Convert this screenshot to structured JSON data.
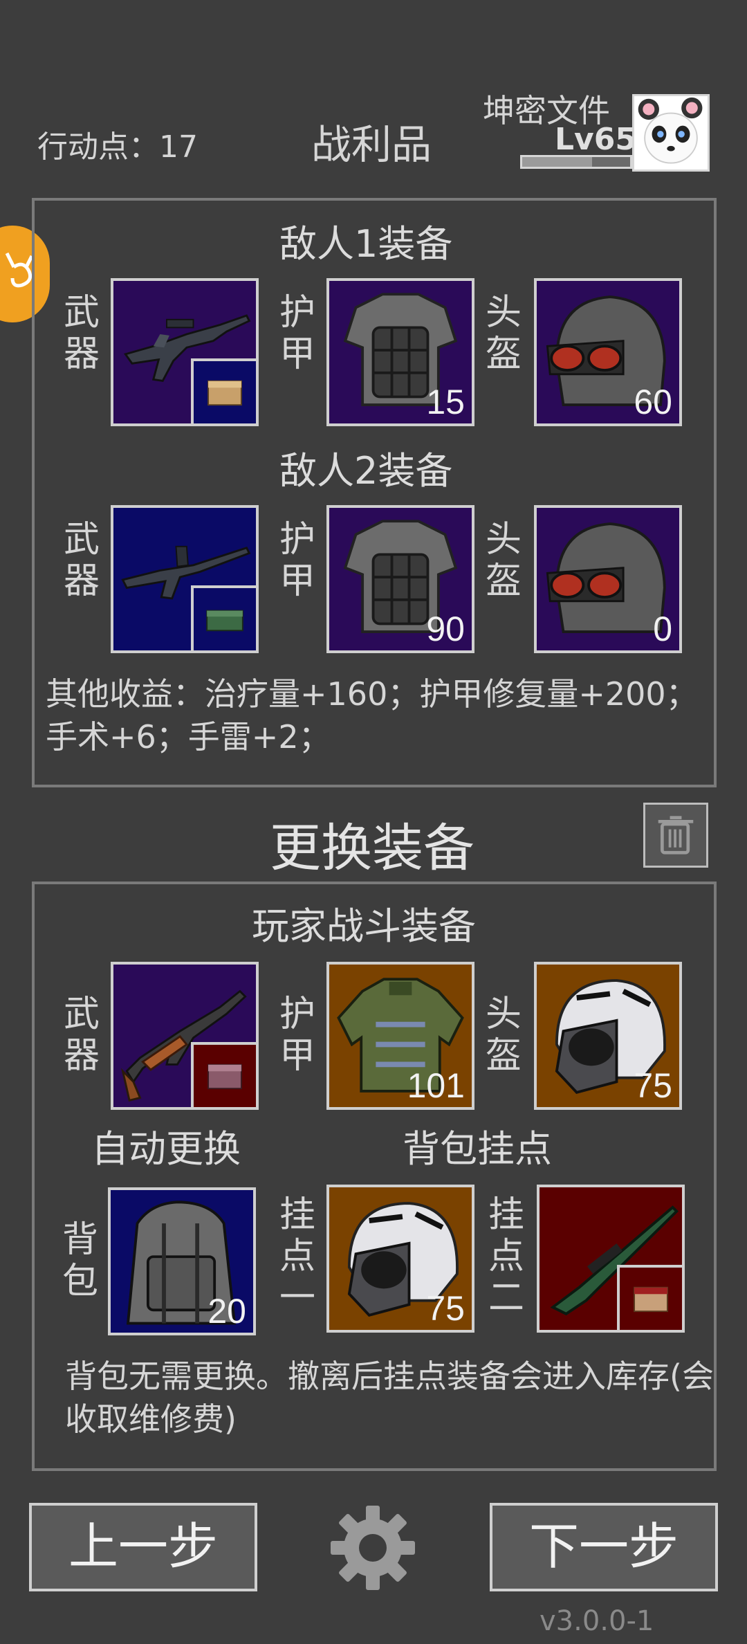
{
  "header": {
    "action_points": "行动点：17",
    "title": "战利品",
    "player_name": "坤密文件",
    "player_level": "Lv65",
    "xp_progress": 0.65,
    "avatar_icon": "panda-avatar-icon"
  },
  "loot": {
    "enemy1_title": "敌人1装备",
    "enemy2_title": "敌人2装备",
    "labels": {
      "weapon": "武器",
      "armor": "护甲",
      "helmet": "头盔"
    },
    "enemy1": {
      "armor_value": "15",
      "helmet_value": "60"
    },
    "enemy2": {
      "armor_value": "90",
      "helmet_value": "0"
    },
    "other_gains": "其他收益：治疗量+160；护甲修复量+200；手术+6；手雷+2；"
  },
  "change": {
    "title": "更换装备",
    "player_title": "玩家战斗装备",
    "armor_value": "101",
    "helmet_value": "75",
    "auto_replace": "自动更换",
    "backpack_mount_title": "背包挂点",
    "labels": {
      "backpack": "背包",
      "mount1": "挂点一",
      "mount2": "挂点二"
    },
    "backpack_value": "20",
    "mount1_value": "75",
    "note": "背包无需更换。撤离后挂点装备会进入库存(会收取维修费)"
  },
  "footer": {
    "prev_label": "上一步",
    "next_label": "下一步",
    "version": "v3.0.0-1"
  },
  "colors": {
    "background": "#3d3d3d",
    "slot_purple": "#2a0a58",
    "slot_blue": "#0a0a66",
    "slot_orange": "#7a4200",
    "slot_red": "#5a0000",
    "side_tab": "#f0a020"
  }
}
